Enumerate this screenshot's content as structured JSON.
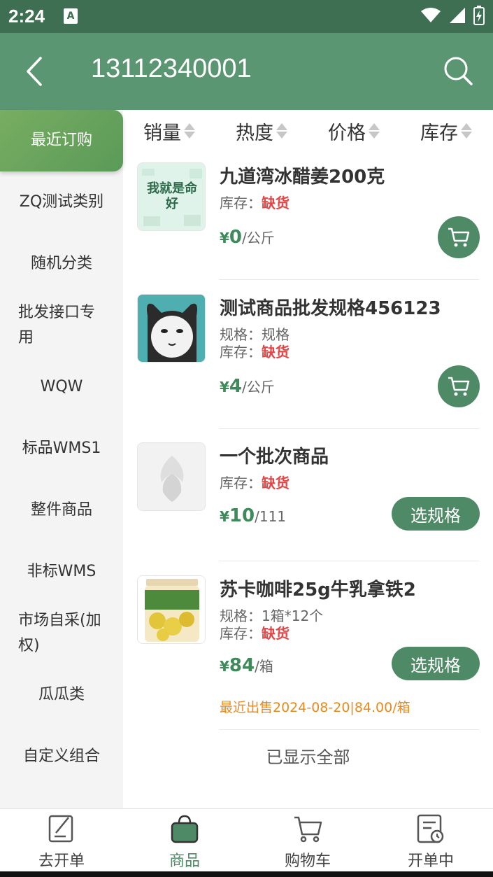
{
  "status": {
    "time": "2:24",
    "notif_icon": "A"
  },
  "header": {
    "title": "13112340001"
  },
  "sidebar": {
    "items": [
      {
        "label": "最近订购"
      },
      {
        "label": "ZQ测试类别"
      },
      {
        "label": "随机分类"
      },
      {
        "label": "批发接口专用"
      },
      {
        "label": "WQW"
      },
      {
        "label": "标品WMS1"
      },
      {
        "label": "整件商品"
      },
      {
        "label": "非标WMS"
      },
      {
        "label": "市场自采(加权)"
      },
      {
        "label": "瓜瓜类"
      },
      {
        "label": "自定义组合"
      }
    ]
  },
  "sort": {
    "sales": "销量",
    "heat": "热度",
    "price": "价格",
    "stock": "库存"
  },
  "products": [
    {
      "name": "九道湾冰醋姜200克",
      "stock_label": "库存：",
      "stock_value": "缺货",
      "price_cur": "¥",
      "price_num": "0",
      "price_unit": "/公斤",
      "thumb_text": "我就是命好"
    },
    {
      "name": "测试商品批发规格456123",
      "spec": "规格：规格",
      "stock_label": "库存：",
      "stock_value": "缺货",
      "price_cur": "¥",
      "price_num": "4",
      "price_unit": "/公斤"
    },
    {
      "name": "一个批次商品",
      "stock_label": "库存：",
      "stock_value": "缺货",
      "price_cur": "¥",
      "price_num": "10",
      "price_unit": "/111",
      "button": "选规格"
    },
    {
      "name": "苏卡咖啡25g牛乳拿铁2",
      "spec": "规格：1箱*12个",
      "stock_label": "库存：",
      "stock_value": "缺货",
      "price_cur": "¥",
      "price_num": "84",
      "price_unit": "/箱",
      "button": "选规格",
      "recent": "最近出售2024-08-20|84.00/箱"
    }
  ],
  "footer_note": "已显示全部",
  "tabs": [
    {
      "label": "去开单"
    },
    {
      "label": "商品"
    },
    {
      "label": "购物车"
    },
    {
      "label": "开单中"
    }
  ],
  "colors": {
    "header": "#5b9672",
    "statusbar": "#3f6f52",
    "accent": "#4e8a66",
    "out_of_stock": "#e64545",
    "recent": "#e88a1e"
  }
}
